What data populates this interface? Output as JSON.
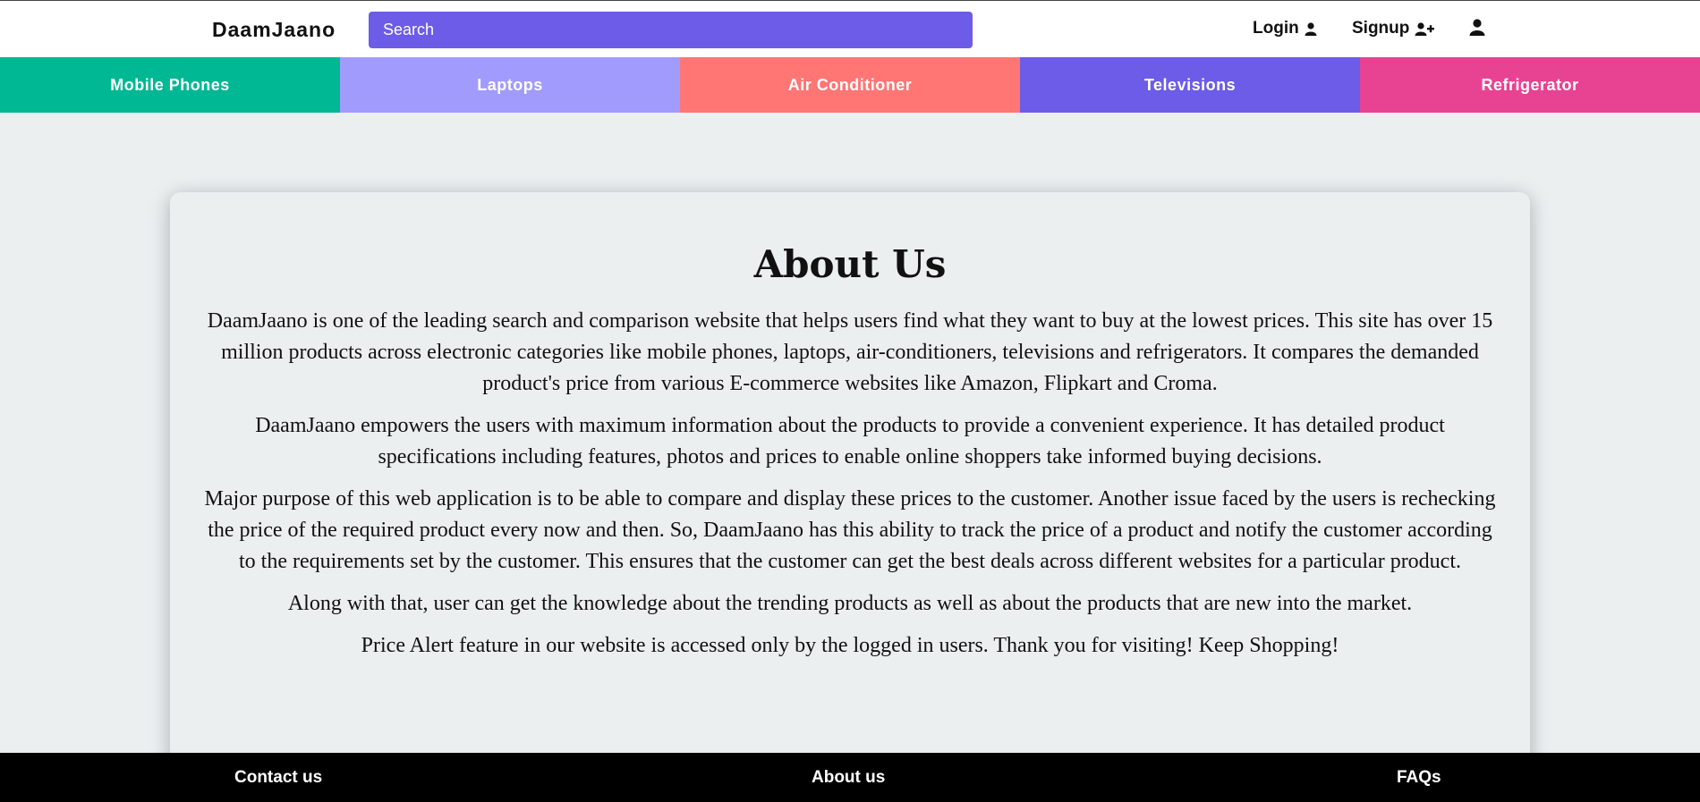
{
  "header": {
    "brand": "DaamJaano",
    "search_placeholder": "Search",
    "login_label": "Login",
    "signup_label": "Signup",
    "icons": [
      "user-icon",
      "user-plus-icon",
      "profile-icon"
    ]
  },
  "categories": [
    {
      "label": "Mobile Phones",
      "color": "#00b894"
    },
    {
      "label": "Laptops",
      "color": "#a29bfe"
    },
    {
      "label": "Air Conditioner",
      "color": "#ff7675"
    },
    {
      "label": "Televisions",
      "color": "#6c5ce7"
    },
    {
      "label": "Refrigerator",
      "color": "#e84393"
    }
  ],
  "about": {
    "title": "About Us",
    "paragraphs": [
      "DaamJaano is one of the leading search and comparison website that helps users find what they want to buy at the lowest prices. This site has over 15 million products across electronic categories like mobile phones, laptops, air-conditioners, televisions and refrigerators. It compares the demanded product's price from various E-commerce websites like Amazon, Flipkart and Croma.",
      "DaamJaano empowers the users with maximum information about the products to provide a convenient experience. It has detailed product specifications including features, photos and prices to enable online shoppers take informed buying decisions.",
      "Major purpose of this web application is to be able to compare and display these prices to the customer. Another issue faced by the users is rechecking the price of the required product every now and then. So, DaamJaano has this ability to track the price of a product and notify the customer according to the requirements set by the customer. This ensures that the customer can get the best deals across different websites for a particular product.",
      "Along with that, user can get the knowledge about the trending products as well as about the products that are new into the market.",
      "Price Alert feature in our website is accessed only by the logged in users. Thank you for visiting! Keep Shopping!"
    ]
  },
  "footer": {
    "contact_label": "Contact us",
    "about_label": "About us",
    "faqs_label": "FAQs"
  }
}
